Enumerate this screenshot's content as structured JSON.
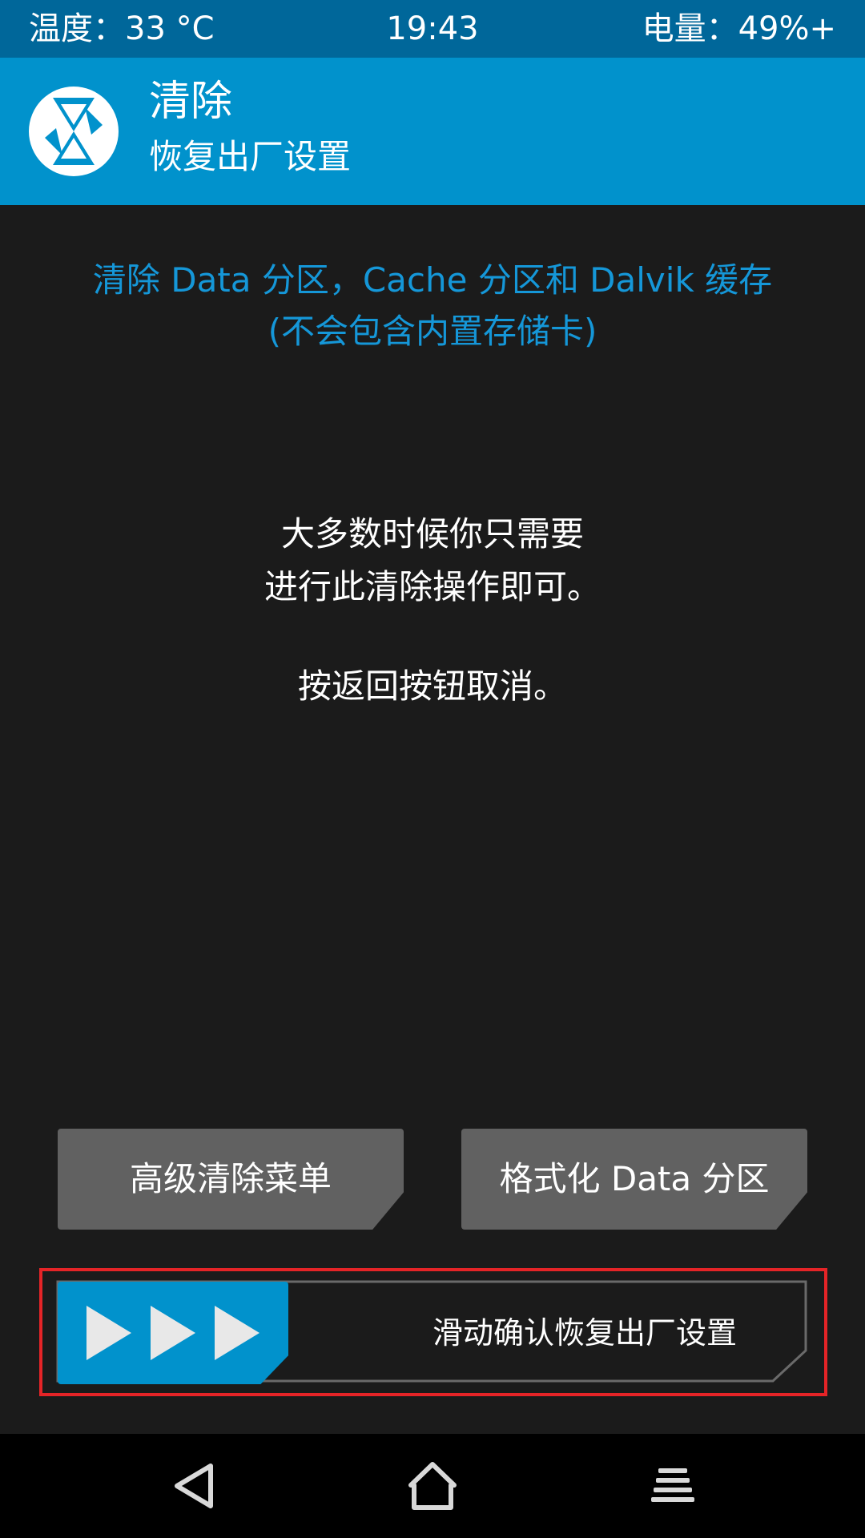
{
  "status_bar": {
    "temperature": "温度：33 °C",
    "time": "19:43",
    "battery": "电量：49%+"
  },
  "header": {
    "title": "清除",
    "subtitle": "恢复出厂设置",
    "logo_icon": "twrp-logo-icon"
  },
  "description": {
    "line1": "清除 Data 分区，Cache 分区和 Dalvik 缓存",
    "line2": "(不会包含内置存储卡)",
    "color": "#1597d8"
  },
  "info": {
    "line1": "大多数时候你只需要",
    "line2": "进行此清除操作即可。",
    "line3": "按返回按钮取消。"
  },
  "buttons": {
    "advanced_wipe": "高级清除菜单",
    "format_data": "格式化 Data 分区"
  },
  "slider": {
    "label": "滑动确认恢复出厂设置",
    "handle_icon": "triple-play-arrows-icon",
    "accent": "#0192cc",
    "highlight": "#e52427"
  },
  "nav_bar": {
    "back_icon": "back-triangle-icon",
    "home_icon": "home-icon",
    "menu_icon": "menu-icon"
  }
}
